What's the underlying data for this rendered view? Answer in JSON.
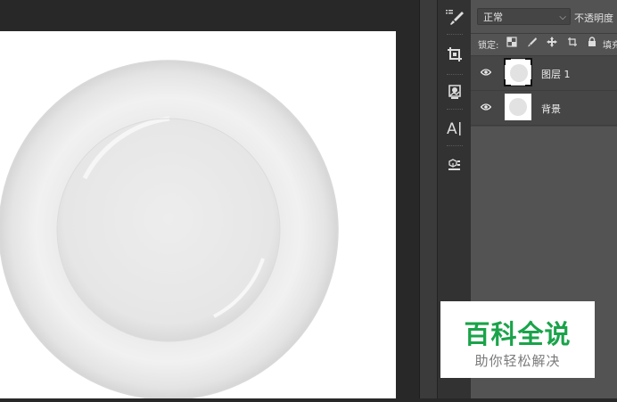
{
  "layers_panel": {
    "blend_mode": "正常",
    "opacity_label": "不透明度",
    "lock_label": "锁定:",
    "fill_label": "填充",
    "layers": [
      {
        "name": "图层 1",
        "visible": true,
        "selected": true
      },
      {
        "name": "背景",
        "visible": true,
        "selected": false
      }
    ]
  },
  "tools": [
    "brush-tool-icon",
    "crop-tool-icon",
    "stamp-tool-icon",
    "text-tool-icon",
    "3d-object-icon"
  ],
  "watermark": {
    "title": "百科全说",
    "subtitle": "助你轻松解决",
    "title_color": "#1aa34a"
  },
  "colors": {
    "canvas": "#ffffff",
    "workspace": "#282828",
    "panel": "#535353",
    "layer_row": "#464646"
  }
}
